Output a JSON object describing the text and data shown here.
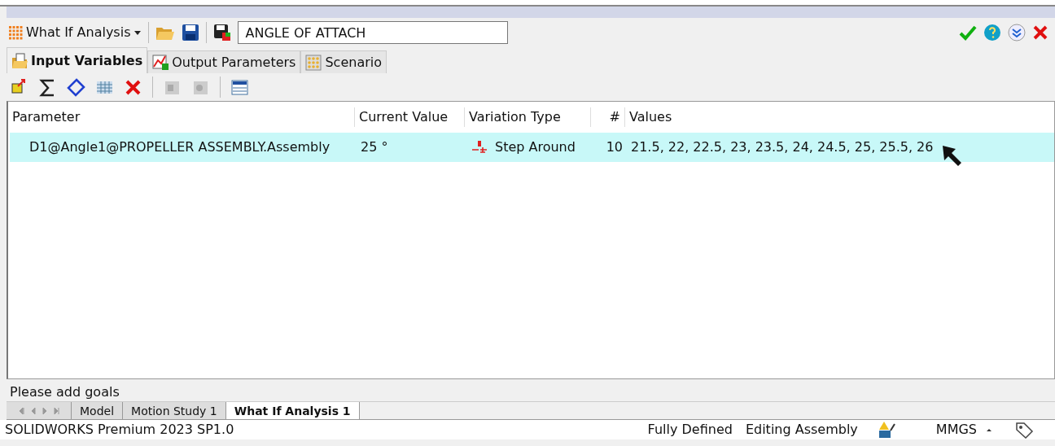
{
  "toolbar": {
    "tool_name": "What If Analysis",
    "study_name": "ANGLE OF ATTACH"
  },
  "tabs": [
    {
      "label": "Input Variables",
      "selected": true
    },
    {
      "label": "Output Parameters",
      "selected": false
    },
    {
      "label": "Scenario",
      "selected": false
    }
  ],
  "table": {
    "columns": [
      "Parameter",
      "Current Value",
      "Variation Type",
      "#",
      "Values"
    ],
    "rows": [
      {
        "selected": true,
        "cells": [
          "D1@Angle1@PROPELLER ASSEMBLY.Assembly",
          "25 °",
          "Step Around",
          "10",
          "21.5, 22, 22.5, 23, 23.5, 24, 24.5, 25, 25.5, 26"
        ]
      }
    ]
  },
  "message": "Please add goals",
  "bottom_tabs": [
    {
      "label": "Model",
      "selected": false
    },
    {
      "label": "Motion Study 1",
      "selected": false
    },
    {
      "label": "What If Analysis 1",
      "selected": true
    }
  ],
  "status_bar": {
    "product": "SOLIDWORKS Premium 2023 SP1.0",
    "state": "Fully Defined",
    "mode": "Editing Assembly",
    "units": "MMGS"
  }
}
